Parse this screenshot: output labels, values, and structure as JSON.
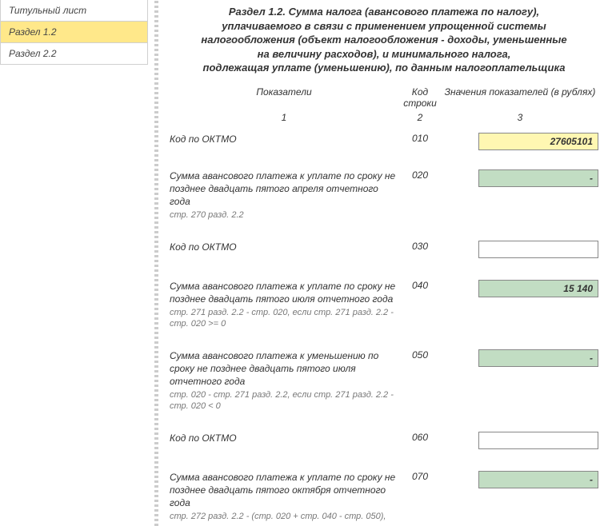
{
  "sidebar": {
    "items": [
      {
        "label": "Титульный лист",
        "active": false
      },
      {
        "label": "Раздел 1.2",
        "active": true
      },
      {
        "label": "Раздел 2.2",
        "active": false
      }
    ]
  },
  "header": {
    "l1": "Раздел 1.2. Сумма налога (авансового платежа по налогу),",
    "l2": "уплачиваемого в связи с применением упрощенной системы",
    "l3": "налогообложения (объект налогообложения - доходы, уменьшенные",
    "l4": "на величину расходов), и минимального налога,",
    "l5": "подлежащая уплате (уменьшению), по данным налогоплательщика"
  },
  "columns": {
    "indicator": "Показатели",
    "code": "Код строки",
    "value": "Значения показателей (в рублях)",
    "n1": "1",
    "n2": "2",
    "n3": "3"
  },
  "rows": [
    {
      "indicator": "Код по ОКТМО",
      "sub": "",
      "code": "010",
      "value": "27605101",
      "style": "f-yellow"
    },
    {
      "indicator": "Сумма авансового платежа к уплате по сроку не позднее двадцать пятого апреля отчетного года",
      "sub": "стр. 270 разд. 2.2",
      "code": "020",
      "value": "-",
      "style": "f-green"
    },
    {
      "indicator": "Код по ОКТМО",
      "sub": "",
      "code": "030",
      "value": "",
      "style": "f-white"
    },
    {
      "indicator": "Сумма  авансового платежа к уплате по сроку не позднее двадцать пятого июля отчетного года",
      "sub": "стр. 271 разд. 2.2 - стр. 020,\nесли стр. 271 разд. 2.2 - стр. 020 >= 0",
      "code": "040",
      "value": "15 140",
      "style": "f-green"
    },
    {
      "indicator": "Сумма авансового платежа к уменьшению по сроку не позднее двадцать пятого июля отчетного года",
      "sub": "стр. 020 - стр. 271 разд. 2.2,\nесли стр. 271 разд. 2.2 - стр. 020 < 0",
      "code": "050",
      "value": "-",
      "style": "f-green"
    },
    {
      "indicator": "Код по ОКТМО",
      "sub": "",
      "code": "060",
      "value": "",
      "style": "f-white"
    },
    {
      "indicator": "Сумма авансового платежа к уплате по сроку не позднее двадцать пятого октября отчетного года",
      "sub": "стр. 272 разд. 2.2 - (стр. 020 + стр. 040 - стр. 050),",
      "code": "070",
      "value": "-",
      "style": "f-green"
    }
  ]
}
